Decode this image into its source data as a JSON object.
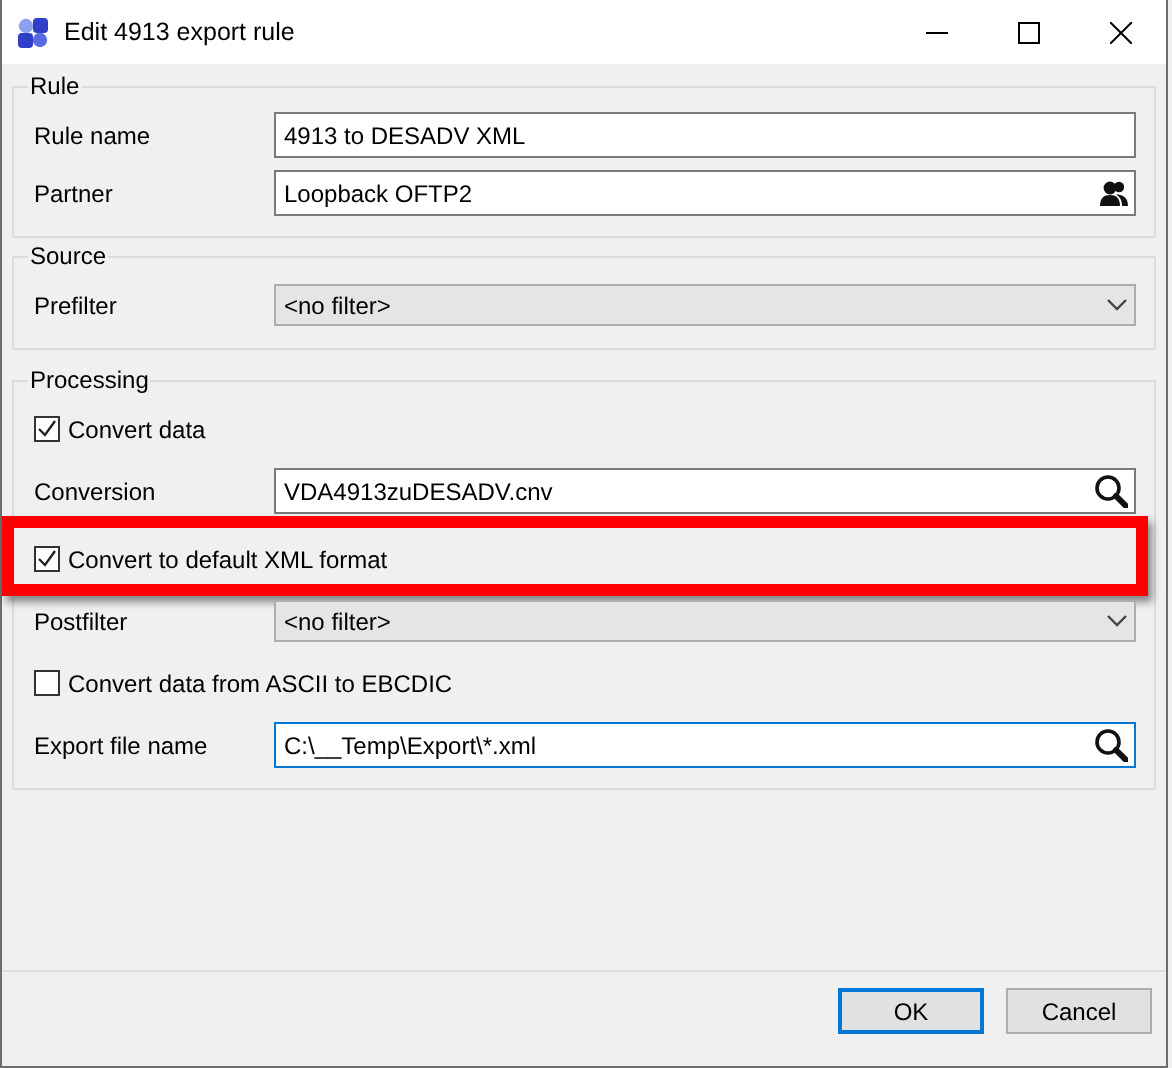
{
  "window": {
    "title": "Edit 4913 export rule"
  },
  "groups": [
    {
      "title": "Rule",
      "rows": [
        {
          "kind": "text",
          "label": "Rule name",
          "value": "4913 to DESADV XML",
          "focused": false
        },
        {
          "kind": "picker",
          "label": "Partner",
          "value": "Loopback OFTP2",
          "focused": false
        }
      ]
    },
    {
      "title": "Source",
      "rows": [
        {
          "kind": "dropdown",
          "label": "Prefilter",
          "value": "<no filter>"
        }
      ]
    },
    {
      "title": "Processing",
      "rows": [
        {
          "kind": "checkbox",
          "label": "Convert data",
          "checked": true,
          "highlighted": false
        },
        {
          "kind": "browse",
          "label": "Conversion",
          "value": "VDA4913zuDESADV.cnv",
          "focused": false
        },
        {
          "kind": "checkbox",
          "label": "Convert to default XML format",
          "checked": true,
          "highlighted": true
        },
        {
          "kind": "dropdown",
          "label": "Postfilter",
          "value": "<no filter>"
        },
        {
          "kind": "checkbox",
          "label": "Convert data from ASCII to EBCDIC",
          "checked": false,
          "highlighted": false
        },
        {
          "kind": "browse",
          "label": "Export file name",
          "value": "C:\\__Temp\\Export\\*.xml",
          "focused": true
        }
      ]
    }
  ],
  "buttons": [
    {
      "label": "OK",
      "default": true
    },
    {
      "label": "Cancel",
      "default": false
    }
  ]
}
